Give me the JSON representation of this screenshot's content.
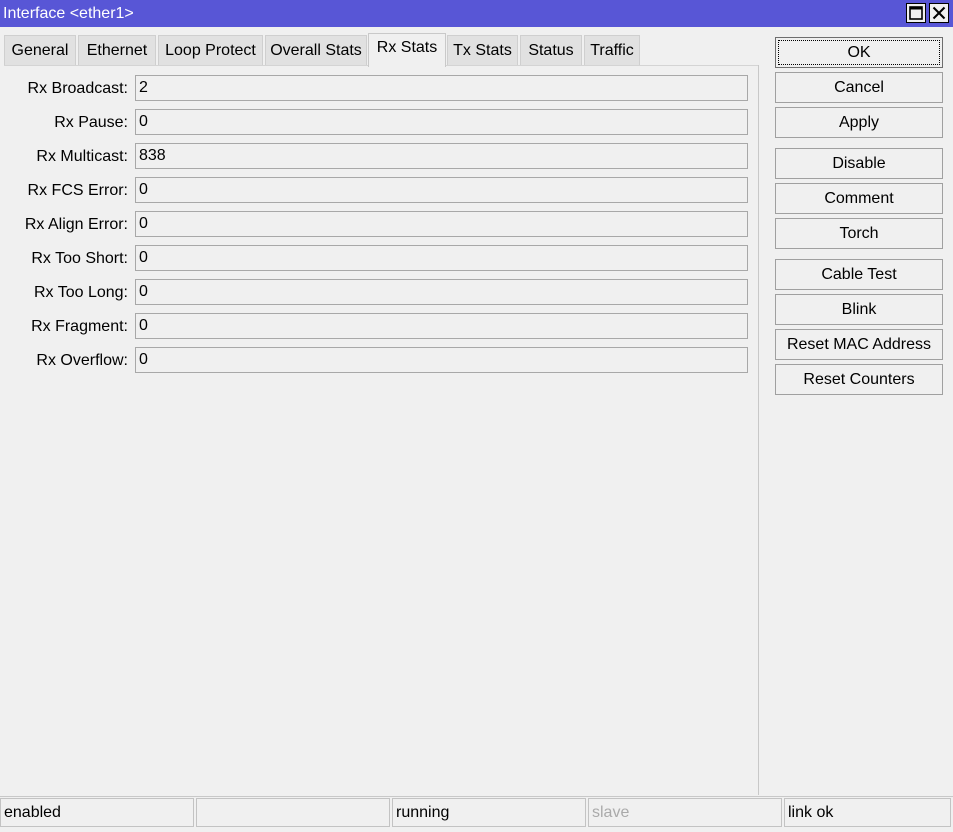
{
  "window": {
    "title": "Interface <ether1>"
  },
  "colors": {
    "titlebar": "#5856d6",
    "background": "#f0f0f0"
  },
  "tabs": [
    {
      "label": "General"
    },
    {
      "label": "Ethernet"
    },
    {
      "label": "Loop Protect"
    },
    {
      "label": "Overall Stats"
    },
    {
      "label": "Rx Stats",
      "active": true
    },
    {
      "label": "Tx Stats"
    },
    {
      "label": "Status"
    },
    {
      "label": "Traffic"
    }
  ],
  "fields": [
    {
      "label": "Rx Broadcast:",
      "value": "2"
    },
    {
      "label": "Rx Pause:",
      "value": "0"
    },
    {
      "label": "Rx Multicast:",
      "value": "838"
    },
    {
      "label": "Rx FCS Error:",
      "value": "0"
    },
    {
      "label": "Rx Align Error:",
      "value": "0"
    },
    {
      "label": "Rx Too Short:",
      "value": "0"
    },
    {
      "label": "Rx Too Long:",
      "value": "0"
    },
    {
      "label": "Rx Fragment:",
      "value": "0"
    },
    {
      "label": "Rx Overflow:",
      "value": "0"
    }
  ],
  "buttons": {
    "ok": "OK",
    "cancel": "Cancel",
    "apply": "Apply",
    "disable": "Disable",
    "comment": "Comment",
    "torch": "Torch",
    "cable_test": "Cable Test",
    "blink": "Blink",
    "reset_mac": "Reset MAC Address",
    "reset_counters": "Reset Counters"
  },
  "status": {
    "state": "enabled",
    "empty": "",
    "running": "running",
    "slave": "slave",
    "link": "link ok"
  }
}
